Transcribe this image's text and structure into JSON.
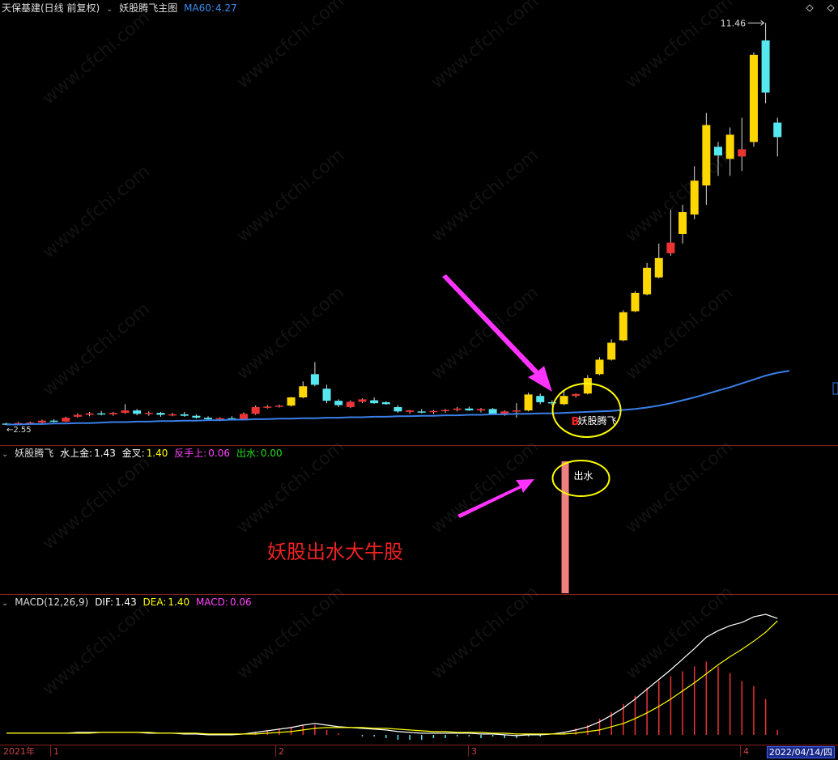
{
  "main_header": {
    "stock": "天保基建(日线 前复权)",
    "indicator": "妖股腾飞主图",
    "ma_label": "MA60:",
    "ma_value": "4.27"
  },
  "sub1_header": {
    "name": "妖股腾飞",
    "items": [
      {
        "label": "水上金:",
        "value": "1.43",
        "color": "#ffffff"
      },
      {
        "label": "金叉:",
        "value": "1.40",
        "color": "#ffff00"
      },
      {
        "label": "反手上:",
        "value": "0.06",
        "color": "#ff44ff"
      },
      {
        "label": "出水:",
        "value": "0.00",
        "color": "#22dd22"
      }
    ]
  },
  "macd_header": {
    "name": "MACD(12,26,9)",
    "dif_label": "DIF:",
    "dif": "1.43",
    "dea_label": "DEA:",
    "dea": "1.40",
    "macd_label": "MACD:",
    "macd": "0.06"
  },
  "annotations": {
    "high_price": "11.46",
    "low_price": "2.55",
    "buy_marker": "B",
    "signal_text": "妖股腾飞",
    "water_text": "出水",
    "headline": "妖股出水大牛股"
  },
  "time_axis": {
    "year_label": "2021年",
    "months": [
      "1",
      "2",
      "3",
      "4"
    ],
    "current_date": "2022/04/14/四"
  },
  "watermark": "www.cfchi.com",
  "colors": {
    "up_yellow": "#ffd700",
    "up_red": "#ee3333",
    "down_cyan": "#55e8f0",
    "ma_blue": "#3a7fe8",
    "water_bar": "#f08080",
    "arrow_magenta": "#ff33ff",
    "circle_yellow": "#ffff00",
    "separator": "#8a1f1f"
  },
  "chart_data": [
    {
      "type": "candlestick",
      "title": "妖股腾飞主图",
      "series": [
        {
          "name": "MA60",
          "values": [
            3.16,
            3.16,
            3.17,
            3.17,
            3.18,
            3.18,
            3.19,
            3.19,
            3.2,
            3.21,
            3.21,
            3.22,
            3.22,
            3.23,
            3.23,
            3.24,
            3.24,
            3.25,
            3.25,
            3.26,
            3.26,
            3.27,
            3.27,
            3.28,
            3.28,
            3.29,
            3.29,
            3.3,
            3.3,
            3.31,
            3.31,
            3.32,
            3.32,
            3.33,
            3.33,
            3.34,
            3.34,
            3.35,
            3.35,
            3.36,
            3.36,
            3.37,
            3.37,
            3.38,
            3.38,
            3.39,
            3.39,
            3.4,
            3.41,
            3.42,
            3.43,
            3.44,
            3.46,
            3.48,
            3.51,
            3.55,
            3.6,
            3.66,
            3.72,
            3.79,
            3.86,
            3.93,
            4.01,
            4.09,
            4.17,
            4.23,
            4.27
          ]
        }
      ],
      "ohlc": [
        [
          3.18,
          3.2,
          3.14,
          3.17
        ],
        [
          3.18,
          3.21,
          3.15,
          3.19
        ],
        [
          3.19,
          3.22,
          3.16,
          3.2
        ],
        [
          3.2,
          3.26,
          3.18,
          3.24
        ],
        [
          3.24,
          3.27,
          3.2,
          3.22
        ],
        [
          3.22,
          3.32,
          3.21,
          3.3
        ],
        [
          3.32,
          3.39,
          3.3,
          3.36
        ],
        [
          3.36,
          3.42,
          3.33,
          3.39
        ],
        [
          3.39,
          3.44,
          3.35,
          3.37
        ],
        [
          3.37,
          3.42,
          3.34,
          3.4
        ],
        [
          3.4,
          3.58,
          3.38,
          3.45
        ],
        [
          3.45,
          3.48,
          3.35,
          3.38
        ],
        [
          3.38,
          3.43,
          3.34,
          3.4
        ],
        [
          3.4,
          3.42,
          3.32,
          3.36
        ],
        [
          3.36,
          3.4,
          3.33,
          3.37
        ],
        [
          3.37,
          3.42,
          3.32,
          3.34
        ],
        [
          3.34,
          3.37,
          3.28,
          3.3
        ],
        [
          3.3,
          3.33,
          3.26,
          3.27
        ],
        [
          3.27,
          3.31,
          3.24,
          3.29
        ],
        [
          3.29,
          3.33,
          3.25,
          3.26
        ],
        [
          3.26,
          3.41,
          3.25,
          3.38
        ],
        [
          3.38,
          3.55,
          3.36,
          3.52
        ],
        [
          3.52,
          3.56,
          3.49,
          3.53
        ],
        [
          3.53,
          3.57,
          3.51,
          3.55
        ],
        [
          3.55,
          3.73,
          3.53,
          3.72
        ],
        [
          3.72,
          4.05,
          3.7,
          3.95
        ],
        [
          4.2,
          4.45,
          3.95,
          3.98
        ],
        [
          3.9,
          3.98,
          3.6,
          3.65
        ],
        [
          3.65,
          3.68,
          3.52,
          3.56
        ],
        [
          3.52,
          3.66,
          3.5,
          3.63
        ],
        [
          3.63,
          3.7,
          3.6,
          3.68
        ],
        [
          3.66,
          3.72,
          3.59,
          3.6
        ],
        [
          3.62,
          3.64,
          3.57,
          3.58
        ],
        [
          3.52,
          3.56,
          3.4,
          3.43
        ],
        [
          3.42,
          3.46,
          3.38,
          3.45
        ],
        [
          3.43,
          3.48,
          3.39,
          3.41
        ],
        [
          3.42,
          3.46,
          3.38,
          3.44
        ],
        [
          3.44,
          3.48,
          3.4,
          3.46
        ],
        [
          3.46,
          3.52,
          3.43,
          3.49
        ],
        [
          3.49,
          3.53,
          3.44,
          3.45
        ],
        [
          3.45,
          3.5,
          3.41,
          3.48
        ],
        [
          3.48,
          3.5,
          3.36,
          3.38
        ],
        [
          3.38,
          3.45,
          3.34,
          3.43
        ],
        [
          3.43,
          3.6,
          3.3,
          3.45
        ],
        [
          3.45,
          3.82,
          3.43,
          3.78
        ],
        [
          3.75,
          3.8,
          3.58,
          3.62
        ],
        [
          3.62,
          3.66,
          3.55,
          3.6
        ],
        [
          3.58,
          3.86,
          3.56,
          3.75
        ],
        [
          3.75,
          3.8,
          3.72,
          3.79
        ],
        [
          3.8,
          4.18,
          3.78,
          4.12
        ],
        [
          4.2,
          4.55,
          4.18,
          4.5
        ],
        [
          4.5,
          4.92,
          4.48,
          4.85
        ],
        [
          4.9,
          5.52,
          4.88,
          5.48
        ],
        [
          5.5,
          5.92,
          5.48,
          5.88
        ],
        [
          5.85,
          6.5,
          5.83,
          6.4
        ],
        [
          6.2,
          6.9,
          6.18,
          6.6
        ],
        [
          6.7,
          7.6,
          6.65,
          6.92
        ],
        [
          7.1,
          7.7,
          6.9,
          7.55
        ],
        [
          7.5,
          8.5,
          7.4,
          8.2
        ],
        [
          8.1,
          9.6,
          7.7,
          9.35
        ],
        [
          8.9,
          9.0,
          8.3,
          8.72
        ],
        [
          8.65,
          9.3,
          8.3,
          9.15
        ],
        [
          8.7,
          9.5,
          8.4,
          8.85
        ],
        [
          9.0,
          10.85,
          8.9,
          10.8
        ],
        [
          11.1,
          11.46,
          9.8,
          10.02
        ],
        [
          9.4,
          9.5,
          8.7,
          9.1
        ]
      ],
      "high_label": "11.46",
      "low_label": "2.55"
    },
    {
      "type": "bar",
      "title": "妖股腾飞",
      "series": [
        {
          "name": "水上金",
          "value": 1.43
        },
        {
          "name": "金叉",
          "value": 1.4
        },
        {
          "name": "反手上",
          "value": 0.06
        },
        {
          "name": "出水",
          "value": 0.0
        }
      ]
    },
    {
      "type": "line",
      "title": "MACD(12,26,9)",
      "series": [
        {
          "name": "DIF",
          "values": [
            0.02,
            0.02,
            0.02,
            0.02,
            0.02,
            0.02,
            0.03,
            0.03,
            0.03,
            0.03,
            0.03,
            0.03,
            0.02,
            0.02,
            0.02,
            0.01,
            0.01,
            0.0,
            0.0,
            0.0,
            0.01,
            0.03,
            0.05,
            0.07,
            0.09,
            0.12,
            0.14,
            0.12,
            0.1,
            0.09,
            0.08,
            0.07,
            0.06,
            0.04,
            0.03,
            0.02,
            0.02,
            0.02,
            0.02,
            0.02,
            0.01,
            0.01,
            0.0,
            -0.01,
            0.0,
            0.0,
            0.01,
            0.03,
            0.06,
            0.1,
            0.16,
            0.24,
            0.33,
            0.44,
            0.56,
            0.68,
            0.8,
            0.93,
            1.06,
            1.2,
            1.28,
            1.34,
            1.38,
            1.45,
            1.48,
            1.43
          ]
        },
        {
          "name": "DEA",
          "values": [
            0.02,
            0.02,
            0.02,
            0.02,
            0.02,
            0.02,
            0.02,
            0.02,
            0.03,
            0.03,
            0.03,
            0.03,
            0.03,
            0.02,
            0.02,
            0.02,
            0.02,
            0.01,
            0.01,
            0.01,
            0.01,
            0.01,
            0.02,
            0.03,
            0.04,
            0.06,
            0.08,
            0.09,
            0.09,
            0.09,
            0.09,
            0.08,
            0.08,
            0.07,
            0.06,
            0.05,
            0.04,
            0.04,
            0.03,
            0.03,
            0.03,
            0.02,
            0.02,
            0.01,
            0.01,
            0.01,
            0.01,
            0.01,
            0.02,
            0.04,
            0.06,
            0.1,
            0.14,
            0.2,
            0.27,
            0.35,
            0.44,
            0.54,
            0.64,
            0.75,
            0.86,
            0.96,
            1.05,
            1.15,
            1.26,
            1.4
          ]
        },
        {
          "name": "MACD",
          "values": [
            0,
            0,
            0,
            0,
            0,
            0,
            0,
            0,
            0,
            0,
            0,
            0,
            0,
            0,
            0,
            0,
            0,
            0,
            0,
            0,
            0,
            0.04,
            0.06,
            0.08,
            0.1,
            0.12,
            0.12,
            0.06,
            0.02,
            0,
            -0.02,
            -0.02,
            -0.04,
            -0.06,
            -0.06,
            -0.06,
            -0.04,
            -0.04,
            -0.02,
            -0.02,
            -0.04,
            -0.02,
            -0.04,
            -0.04,
            -0.02,
            -0.02,
            0,
            0.04,
            0.08,
            0.12,
            0.2,
            0.28,
            0.38,
            0.48,
            0.58,
            0.66,
            0.72,
            0.78,
            0.84,
            0.9,
            0.84,
            0.76,
            0.66,
            0.6,
            0.44,
            0.06
          ]
        }
      ]
    }
  ]
}
